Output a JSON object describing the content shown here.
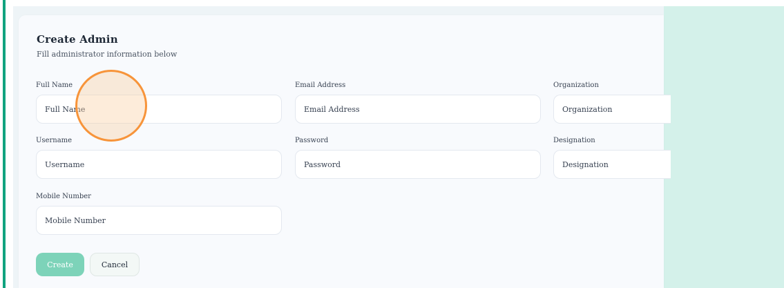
{
  "form": {
    "title": "Create Admin",
    "subtitle": "Fill administrator information below",
    "fields": {
      "full_name": {
        "label": "Full Name",
        "placeholder": "Full Name"
      },
      "email": {
        "label": "Email Address",
        "placeholder": "Email Address"
      },
      "organization": {
        "label": "Organization",
        "placeholder": "Organization"
      },
      "username": {
        "label": "Username",
        "placeholder": "Username"
      },
      "password": {
        "label": "Password",
        "placeholder": "Password"
      },
      "designation": {
        "label": "Designation",
        "placeholder": "Designation"
      },
      "mobile": {
        "label": "Mobile Number",
        "placeholder": "Mobile Number"
      }
    },
    "buttons": {
      "create_label": "Create",
      "cancel_label": "Cancel"
    }
  },
  "colors": {
    "accent": "#10a37f",
    "primary_button": "#7dd3b9",
    "side_panel": "#d4f1ea",
    "click_indicator": "#f7943a"
  }
}
